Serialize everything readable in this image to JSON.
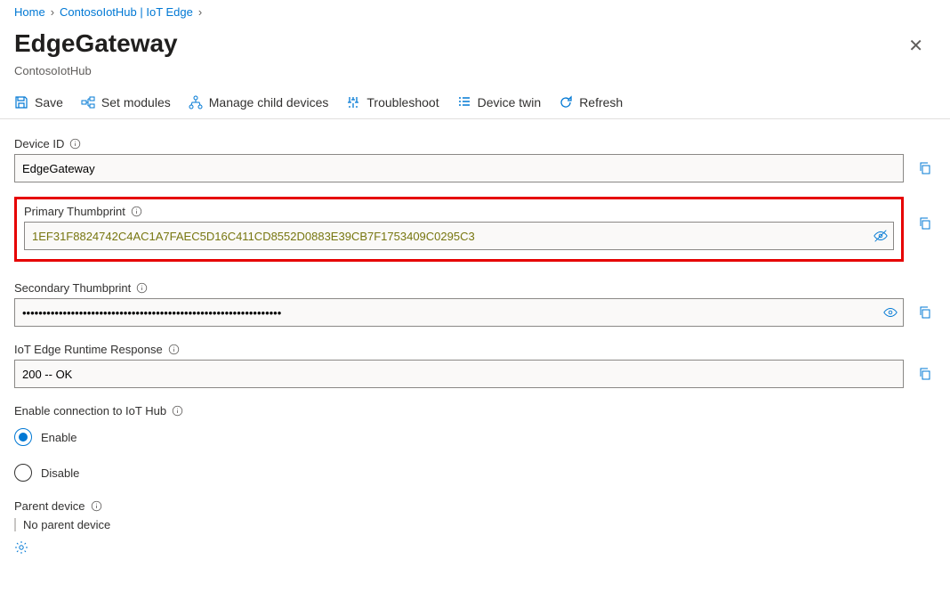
{
  "breadcrumb": {
    "home": "Home",
    "hub": "ContosoIotHub | IoT Edge"
  },
  "header": {
    "title": "EdgeGateway",
    "subtitle": "ContosoIotHub"
  },
  "toolbar": {
    "save": "Save",
    "set_modules": "Set modules",
    "manage_child": "Manage child devices",
    "troubleshoot": "Troubleshoot",
    "device_twin": "Device twin",
    "refresh": "Refresh"
  },
  "fields": {
    "device_id_label": "Device ID",
    "device_id_value": "EdgeGateway",
    "primary_thumb_label": "Primary Thumbprint",
    "primary_thumb_value": "1EF31F8824742C4AC1A7FAEC5D16C411CD8552D0883E39CB7F1753409C0295C3",
    "secondary_thumb_label": "Secondary Thumbprint",
    "secondary_thumb_value": "••••••••••••••••••••••••••••••••••••••••••••••••••••••••••••••••",
    "runtime_label": "IoT Edge Runtime Response",
    "runtime_value": "200 -- OK",
    "enable_conn_label": "Enable connection to IoT Hub",
    "enable_option": "Enable",
    "disable_option": "Disable",
    "parent_device_label": "Parent device",
    "parent_device_value": "No parent device"
  }
}
